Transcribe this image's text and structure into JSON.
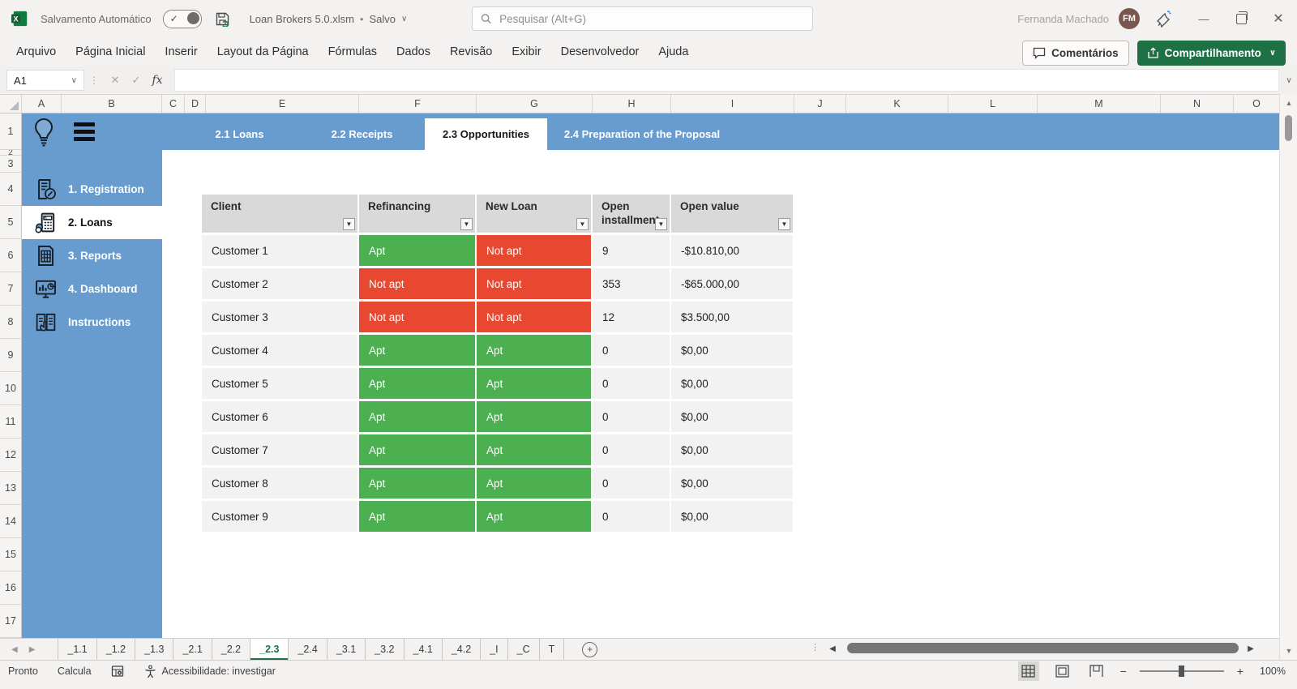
{
  "titlebar": {
    "autosave_label": "Salvamento Automático",
    "filename": "Loan Brokers 5.0.xlsm",
    "separator": "•",
    "file_status": "Salvo",
    "search_placeholder": "Pesquisar (Alt+G)",
    "user_name": "Fernanda Machado",
    "user_initials": "FM"
  },
  "menubar": {
    "items": [
      "Arquivo",
      "Página Inicial",
      "Inserir",
      "Layout da Página",
      "Fórmulas",
      "Dados",
      "Revisão",
      "Exibir",
      "Desenvolvedor",
      "Ajuda"
    ],
    "comments_label": "Comentários",
    "share_label": "Compartilhamento"
  },
  "formulabar": {
    "name_box": "A1",
    "fx_label": "fx",
    "formula_value": ""
  },
  "grid": {
    "columns": [
      "A",
      "B",
      "C",
      "D",
      "E",
      "F",
      "G",
      "H",
      "I",
      "J",
      "K",
      "L",
      "M",
      "N",
      "O"
    ],
    "rows": [
      "1",
      "2",
      "3",
      "4",
      "5",
      "6",
      "7",
      "8",
      "9",
      "10",
      "11",
      "12",
      "13",
      "14",
      "15",
      "16",
      "17"
    ]
  },
  "workbook_ui": {
    "nav_tabs": [
      {
        "label": "2.1 Loans"
      },
      {
        "label": "2.2 Receipts"
      },
      {
        "label": "2.3 Opportunities"
      },
      {
        "label": "2.4 Preparation of the Proposal"
      }
    ],
    "sidebar_items": [
      {
        "label": "1. Registration"
      },
      {
        "label": "2. Loans"
      },
      {
        "label": "3. Reports"
      },
      {
        "label": "4. Dashboard"
      },
      {
        "label": "Instructions"
      }
    ]
  },
  "table": {
    "headers": [
      "Client",
      "Refinancing",
      "New Loan",
      "Open installment",
      "Open value"
    ],
    "rows": [
      {
        "client": "Customer 1",
        "refinancing": "Apt",
        "new_loan": "Not apt",
        "open_installment": "9",
        "open_value": "-$10.810,00"
      },
      {
        "client": "Customer 2",
        "refinancing": "Not apt",
        "new_loan": "Not apt",
        "open_installment": "353",
        "open_value": "-$65.000,00"
      },
      {
        "client": "Customer 3",
        "refinancing": "Not apt",
        "new_loan": "Not apt",
        "open_installment": "12",
        "open_value": "$3.500,00"
      },
      {
        "client": "Customer 4",
        "refinancing": "Apt",
        "new_loan": "Apt",
        "open_installment": "0",
        "open_value": "$0,00"
      },
      {
        "client": "Customer 5",
        "refinancing": "Apt",
        "new_loan": "Apt",
        "open_installment": "0",
        "open_value": "$0,00"
      },
      {
        "client": "Customer 6",
        "refinancing": "Apt",
        "new_loan": "Apt",
        "open_installment": "0",
        "open_value": "$0,00"
      },
      {
        "client": "Customer 7",
        "refinancing": "Apt",
        "new_loan": "Apt",
        "open_installment": "0",
        "open_value": "$0,00"
      },
      {
        "client": "Customer 8",
        "refinancing": "Apt",
        "new_loan": "Apt",
        "open_installment": "0",
        "open_value": "$0,00"
      },
      {
        "client": "Customer 9",
        "refinancing": "Apt",
        "new_loan": "Apt",
        "open_installment": "0",
        "open_value": "$0,00"
      }
    ]
  },
  "sheet_tabs": {
    "tabs": [
      "_1.1",
      "_1.2",
      "_1.3",
      "_2.1",
      "_2.2",
      "_2.3",
      "_2.4",
      "_3.1",
      "_3.2",
      "_4.1",
      "_4.2",
      "_I",
      "_C",
      "T"
    ],
    "active": "_2.3"
  },
  "statusbar": {
    "mode": "Pronto",
    "calculate": "Calcula",
    "accessibility": "Acessibilidade: investigar",
    "zoom": "100%"
  },
  "colors": {
    "accent_blue": "#689CCE",
    "apt_green": "#4CAF50",
    "not_apt_red": "#E8482F",
    "share_green": "#1E7145",
    "active_sheet_tab_green": "#217346",
    "avatar_brown": "#7A564E"
  }
}
